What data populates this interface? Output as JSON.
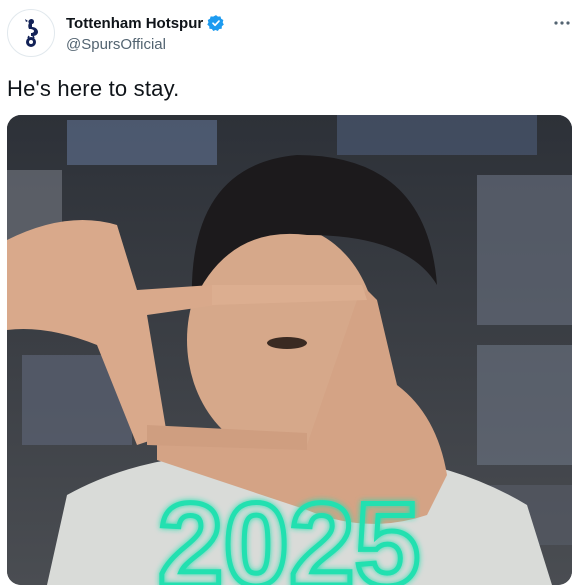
{
  "tweet": {
    "display_name": "Tottenham Hotspur",
    "handle": "@SpursOfficial",
    "text": "He's here to stay.",
    "icons": {
      "avatar": "spurs-cockerel-logo",
      "verified": "verified-badge-icon",
      "more": "more-options-icon"
    },
    "media_overlay_year": "2025"
  },
  "colors": {
    "verified": "#1d9bf0",
    "handle": "#536471",
    "text": "#0f1419",
    "neon": "#22e0b0",
    "logo_navy": "#132257"
  }
}
